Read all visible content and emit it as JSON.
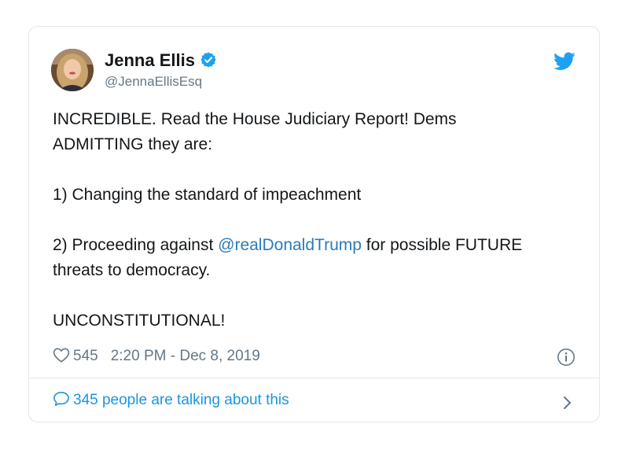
{
  "tweet": {
    "author": {
      "display_name": "Jenna Ellis",
      "handle": "@JennaEllisEsq",
      "verified": true,
      "avatar_icon": "user-photo-avatar"
    },
    "text": {
      "line1_part1": "INCREDIBLE. Read the House Judiciary Report! Dems",
      "line2": "ADMITTING they are:",
      "item1": "1) Changing the standard of impeachment",
      "item2_prefix": "2) Proceeding against ",
      "item2_mention": "@realDonaldTrump",
      "item2_suffix": " for possible FUTURE",
      "item2_line2": "threats to democracy.",
      "closing": "UNCONSTITUTIONAL!"
    },
    "meta": {
      "likes": "545",
      "timestamp": "2:20 PM - Dec 8, 2019"
    },
    "footer": {
      "talking": "345 people are talking about this"
    },
    "icons": {
      "platform": "twitter-bird-icon",
      "like": "heart-icon",
      "info": "info-icon",
      "reply": "speech-bubble-icon",
      "more": "chevron-right-icon"
    },
    "colors": {
      "mention": "#2b7bb9",
      "verified": "#1da1f2",
      "brand": "#1da1f2",
      "muted": "#657786",
      "link": "#1b95e0"
    }
  }
}
